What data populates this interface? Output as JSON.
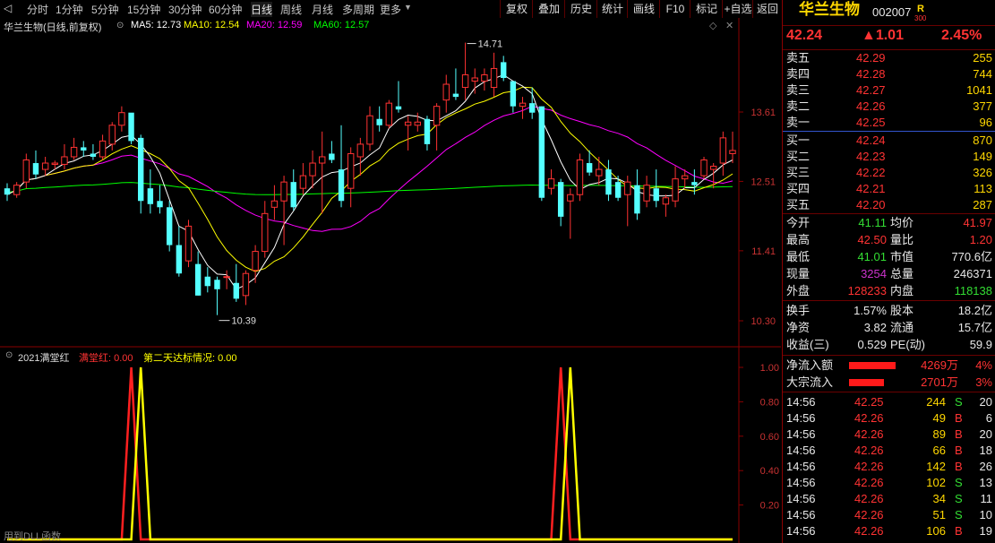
{
  "toolbar": {
    "periods": [
      "分时",
      "1分钟",
      "5分钟",
      "15分钟",
      "30分钟",
      "60分钟",
      "日线",
      "周线",
      "月线",
      "多周期",
      "更多"
    ],
    "active_period": "日线",
    "buttons": [
      "复权",
      "叠加",
      "历史",
      "统计",
      "画线",
      "F10",
      "标记",
      "+自选",
      "返回"
    ]
  },
  "chart_header": {
    "title": "华兰生物(日线,前复权)",
    "ma5": "MA5: 12.73",
    "ma10": "MA10: 12.54",
    "ma20": "MA20: 12.59",
    "ma60": "MA60: 12.57"
  },
  "price_axis": [
    "13.61",
    "12.51",
    "11.41",
    "10.30"
  ],
  "annotations": {
    "high": "14.71",
    "low": "10.39"
  },
  "indicator": {
    "name": "2021满堂红",
    "mtr": "满堂红: 0.00",
    "second": "第二天达标情况: 0.00",
    "axis": [
      "1.00",
      "0.80",
      "0.60",
      "0.40",
      "0.20"
    ],
    "footer": "用到DLL函数"
  },
  "colors": {
    "up": "#ff3232",
    "down": "#54ffff",
    "ma5": "#ffffff",
    "ma10": "#ffff00",
    "ma20": "#ff00ff",
    "ma60": "#00ff00"
  },
  "chart_data": {
    "type": "candlestick",
    "candles": [
      [
        12.4,
        12.48,
        12.2,
        12.3
      ],
      [
        12.3,
        12.5,
        12.25,
        12.45
      ],
      [
        12.5,
        12.95,
        12.4,
        12.85
      ],
      [
        12.8,
        13.0,
        12.55,
        12.62
      ],
      [
        12.7,
        12.9,
        12.6,
        12.8
      ],
      [
        12.78,
        12.84,
        12.7,
        12.8
      ],
      [
        12.78,
        13.1,
        12.7,
        12.9
      ],
      [
        12.9,
        13.2,
        12.85,
        13.05
      ],
      [
        13.05,
        13.15,
        12.9,
        13.0
      ],
      [
        12.95,
        13.1,
        12.85,
        12.9
      ],
      [
        12.9,
        13.25,
        12.85,
        13.15
      ],
      [
        13.1,
        13.45,
        13.0,
        13.4
      ],
      [
        13.4,
        13.7,
        13.3,
        13.6
      ],
      [
        13.6,
        13.5,
        13.1,
        13.15
      ],
      [
        13.2,
        13.25,
        12.0,
        12.2
      ],
      [
        12.4,
        12.7,
        12.0,
        12.15
      ],
      [
        12.2,
        12.45,
        12.0,
        12.1
      ],
      [
        12.1,
        12.2,
        11.4,
        11.5
      ],
      [
        11.5,
        11.8,
        11.0,
        11.05
      ],
      [
        11.25,
        11.9,
        11.15,
        11.8
      ],
      [
        11.2,
        11.4,
        10.7,
        10.7
      ],
      [
        11.0,
        11.15,
        10.75,
        10.85
      ],
      [
        10.95,
        11.0,
        10.39,
        10.8
      ],
      [
        11.0,
        11.1,
        10.8,
        11.0
      ],
      [
        10.9,
        11.2,
        10.6,
        10.65
      ],
      [
        10.7,
        11.1,
        10.55,
        11.05
      ],
      [
        11.1,
        11.5,
        10.9,
        11.4
      ],
      [
        11.4,
        12.2,
        11.3,
        12.0
      ],
      [
        12.1,
        12.45,
        11.9,
        12.2
      ],
      [
        12.2,
        12.6,
        11.5,
        12.5
      ],
      [
        12.5,
        12.7,
        12.05,
        12.1
      ],
      [
        12.4,
        12.8,
        12.3,
        12.6
      ],
      [
        12.6,
        13.0,
        12.4,
        12.8
      ],
      [
        12.8,
        13.3,
        12.0,
        12.9
      ],
      [
        12.95,
        13.15,
        12.8,
        12.85
      ],
      [
        12.7,
        13.4,
        12.1,
        12.2
      ],
      [
        12.4,
        13.05,
        12.1,
        12.95
      ],
      [
        12.9,
        13.2,
        12.6,
        13.1
      ],
      [
        13.1,
        13.7,
        13.0,
        13.55
      ],
      [
        13.5,
        13.7,
        13.3,
        13.4
      ],
      [
        13.4,
        13.8,
        13.35,
        13.75
      ],
      [
        13.7,
        14.1,
        13.6,
        13.65
      ],
      [
        13.4,
        13.55,
        13.0,
        13.45
      ],
      [
        13.4,
        13.6,
        13.3,
        13.45
      ],
      [
        13.5,
        13.55,
        13.0,
        13.1
      ],
      [
        13.4,
        13.75,
        13.0,
        13.7
      ],
      [
        13.8,
        14.2,
        13.6,
        14.05
      ],
      [
        13.9,
        14.3,
        13.8,
        13.85
      ],
      [
        14.0,
        14.71,
        13.8,
        14.2
      ],
      [
        14.1,
        14.3,
        13.9,
        14.15
      ],
      [
        14.1,
        14.3,
        13.95,
        14.2
      ],
      [
        14.0,
        14.55,
        13.85,
        14.3
      ],
      [
        14.4,
        14.5,
        14.1,
        14.15
      ],
      [
        14.1,
        13.8,
        13.6,
        13.7
      ],
      [
        13.7,
        13.85,
        13.5,
        13.75
      ],
      [
        13.75,
        14.0,
        13.5,
        13.6
      ],
      [
        13.7,
        13.7,
        12.2,
        12.25
      ],
      [
        12.4,
        12.7,
        12.3,
        12.55
      ],
      [
        12.5,
        12.55,
        11.8,
        11.95
      ],
      [
        12.2,
        12.4,
        11.6,
        12.3
      ],
      [
        12.3,
        12.95,
        12.2,
        12.85
      ],
      [
        12.8,
        13.0,
        12.6,
        12.65
      ],
      [
        12.6,
        12.9,
        12.45,
        12.7
      ],
      [
        12.7,
        12.85,
        12.2,
        12.3
      ],
      [
        12.5,
        12.6,
        12.2,
        12.25
      ],
      [
        12.3,
        12.6,
        11.8,
        12.5
      ],
      [
        12.45,
        12.7,
        11.9,
        12.0
      ],
      [
        12.2,
        12.6,
        12.1,
        12.45
      ],
      [
        12.4,
        12.7,
        12.1,
        12.2
      ],
      [
        12.15,
        12.3,
        11.95,
        12.25
      ],
      [
        12.2,
        12.75,
        12.1,
        12.55
      ],
      [
        12.55,
        12.7,
        12.4,
        12.6
      ],
      [
        12.5,
        12.7,
        12.3,
        12.45
      ],
      [
        12.6,
        12.9,
        12.55,
        12.85
      ],
      [
        12.7,
        12.8,
        12.4,
        12.75
      ],
      [
        12.8,
        13.3,
        12.6,
        13.2
      ],
      [
        12.95,
        13.3,
        12.8,
        13.0
      ]
    ],
    "ylim": [
      10.0,
      15.0
    ],
    "indicator_peaks": [
      {
        "series": "满堂红",
        "index": 13,
        "value": 1.0
      },
      {
        "series": "第二天达标情况",
        "index": 14,
        "value": 1.0
      },
      {
        "series": "满堂红",
        "index": 58,
        "value": 1.0
      },
      {
        "series": "第二天达标情况",
        "index": 59,
        "value": 1.0
      }
    ],
    "indicator_ylim": [
      0,
      1.05
    ]
  },
  "quote": {
    "name": "华兰生物",
    "code": "002007",
    "flag": "R",
    "flag_sub": "300",
    "price": "42.24",
    "change": "▲1.01",
    "pct": "2.45%",
    "asks": [
      {
        "label": "卖五",
        "price": "42.29",
        "vol": "255"
      },
      {
        "label": "卖四",
        "price": "42.28",
        "vol": "744"
      },
      {
        "label": "卖三",
        "price": "42.27",
        "vol": "1041"
      },
      {
        "label": "卖二",
        "price": "42.26",
        "vol": "377"
      },
      {
        "label": "卖一",
        "price": "42.25",
        "vol": "96"
      }
    ],
    "bids": [
      {
        "label": "买一",
        "price": "42.24",
        "vol": "870"
      },
      {
        "label": "买二",
        "price": "42.23",
        "vol": "149"
      },
      {
        "label": "买三",
        "price": "42.22",
        "vol": "326"
      },
      {
        "label": "买四",
        "price": "42.21",
        "vol": "113"
      },
      {
        "label": "买五",
        "price": "42.20",
        "vol": "287"
      }
    ],
    "stats": [
      {
        "l1": "今开",
        "v1": "41.11",
        "c1": "green",
        "l2": "均价",
        "v2": "41.97",
        "c2": "red"
      },
      {
        "l1": "最高",
        "v1": "42.50",
        "c1": "red",
        "l2": "量比",
        "v2": "1.20",
        "c2": "red"
      },
      {
        "l1": "最低",
        "v1": "41.01",
        "c1": "green",
        "l2": "市值",
        "v2": "770.6亿",
        "c2": "white"
      },
      {
        "l1": "现量",
        "v1": "3254",
        "c1": "purple",
        "l2": "总量",
        "v2": "246371",
        "c2": "white"
      },
      {
        "l1": "外盘",
        "v1": "128233",
        "c1": "red",
        "l2": "内盘",
        "v2": "118138",
        "c2": "green"
      }
    ],
    "stats2": [
      {
        "l1": "换手",
        "v1": "1.57%",
        "l2": "股本",
        "v2": "18.2亿"
      },
      {
        "l1": "净资",
        "v1": "3.82",
        "l2": "流通",
        "v2": "15.7亿"
      },
      {
        "l1": "收益(三)",
        "v1": "0.529",
        "l2": "PE(动)",
        "v2": "59.9"
      }
    ],
    "flows": [
      {
        "label": "净流入额",
        "value": "4269万",
        "pct": "4%",
        "ratio": 0.4
      },
      {
        "label": "大宗流入",
        "value": "2701万",
        "pct": "3%",
        "ratio": 0.3
      }
    ],
    "ticks": [
      {
        "t": "14:56",
        "p": "42.25",
        "v": "244",
        "d": "S",
        "n": "20"
      },
      {
        "t": "14:56",
        "p": "42.26",
        "v": "49",
        "d": "B",
        "n": "6"
      },
      {
        "t": "14:56",
        "p": "42.26",
        "v": "89",
        "d": "B",
        "n": "20"
      },
      {
        "t": "14:56",
        "p": "42.26",
        "v": "66",
        "d": "B",
        "n": "18"
      },
      {
        "t": "14:56",
        "p": "42.26",
        "v": "142",
        "d": "B",
        "n": "26"
      },
      {
        "t": "14:56",
        "p": "42.26",
        "v": "102",
        "d": "S",
        "n": "13"
      },
      {
        "t": "14:56",
        "p": "42.26",
        "v": "34",
        "d": "S",
        "n": "11"
      },
      {
        "t": "14:56",
        "p": "42.26",
        "v": "51",
        "d": "S",
        "n": "10"
      },
      {
        "t": "14:56",
        "p": "42.26",
        "v": "106",
        "d": "B",
        "n": "19"
      }
    ]
  }
}
